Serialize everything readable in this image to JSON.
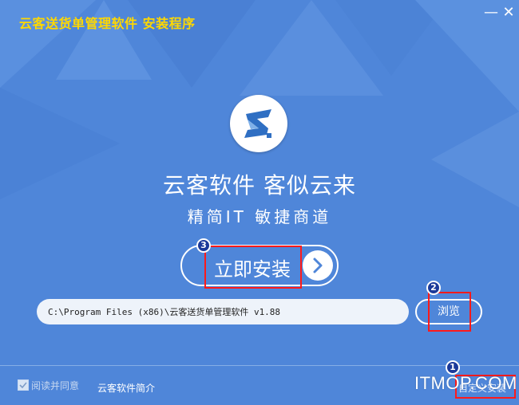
{
  "window": {
    "title": "云客送货单管理软件  安装程序",
    "minimize_glyph": "—",
    "close_glyph": "✕"
  },
  "slogan": {
    "line1": "云客软件  客似云来",
    "line2": "精简IT 敏捷商道"
  },
  "install": {
    "label": "立即安装"
  },
  "path": {
    "value": "C:\\Program Files (x86)\\云客送货单管理软件 v1.88"
  },
  "browse": {
    "label": "浏览"
  },
  "footer": {
    "agree_label": "阅读并同意",
    "intro_link": "云客软件简介",
    "custom_install": "自定义安装"
  },
  "annotations": {
    "badge1": "1",
    "badge2": "2",
    "badge3": "3",
    "watermark": "ITMOP.COM"
  },
  "colors": {
    "background": "#4f86d9",
    "title": "#ffd800",
    "annotation_red": "#ff1a1a",
    "badge": "#1b3a9a"
  },
  "icons": {
    "logo": "yunke-logo-icon",
    "install_arrow": "chevron-right-icon",
    "agree": "checkbox-checked-icon"
  }
}
